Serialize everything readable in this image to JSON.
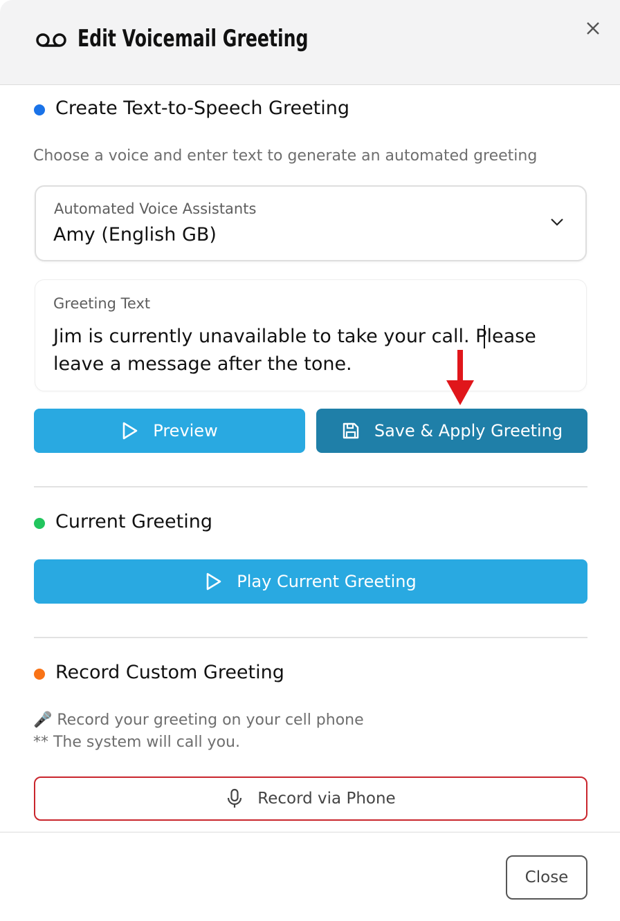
{
  "header": {
    "title": "Edit Voicemail Greeting",
    "icon": "voicemail-icon",
    "close_icon": "close-icon"
  },
  "tts_section": {
    "title": "Create Text-to-Speech Greeting",
    "dot_color": "#1a73e8",
    "description": "Choose a voice and enter text to generate an automated greeting",
    "voice_select": {
      "label": "Automated Voice Assistants",
      "value": "Amy (English GB)"
    },
    "greeting_text": {
      "label": "Greeting Text",
      "value": "Jim is currently unavailable to take your call. Please leave a message after the tone."
    },
    "preview_label": "Preview",
    "save_label": "Save & Apply Greeting"
  },
  "current_section": {
    "title": "Current Greeting",
    "dot_color": "#22c55e",
    "play_label": "Play Current Greeting"
  },
  "record_section": {
    "title": "Record Custom Greeting",
    "dot_color": "#f97316",
    "note_line1": "🎤 Record your greeting on your cell phone",
    "note_line2": "** The system will call you.",
    "record_label": "Record via Phone"
  },
  "footer": {
    "close_label": "Close"
  },
  "colors": {
    "primary_button": "#29a9e1",
    "save_button": "#1f7fa8",
    "record_border": "#c9252c",
    "annotation_arrow": "#e0161b"
  }
}
